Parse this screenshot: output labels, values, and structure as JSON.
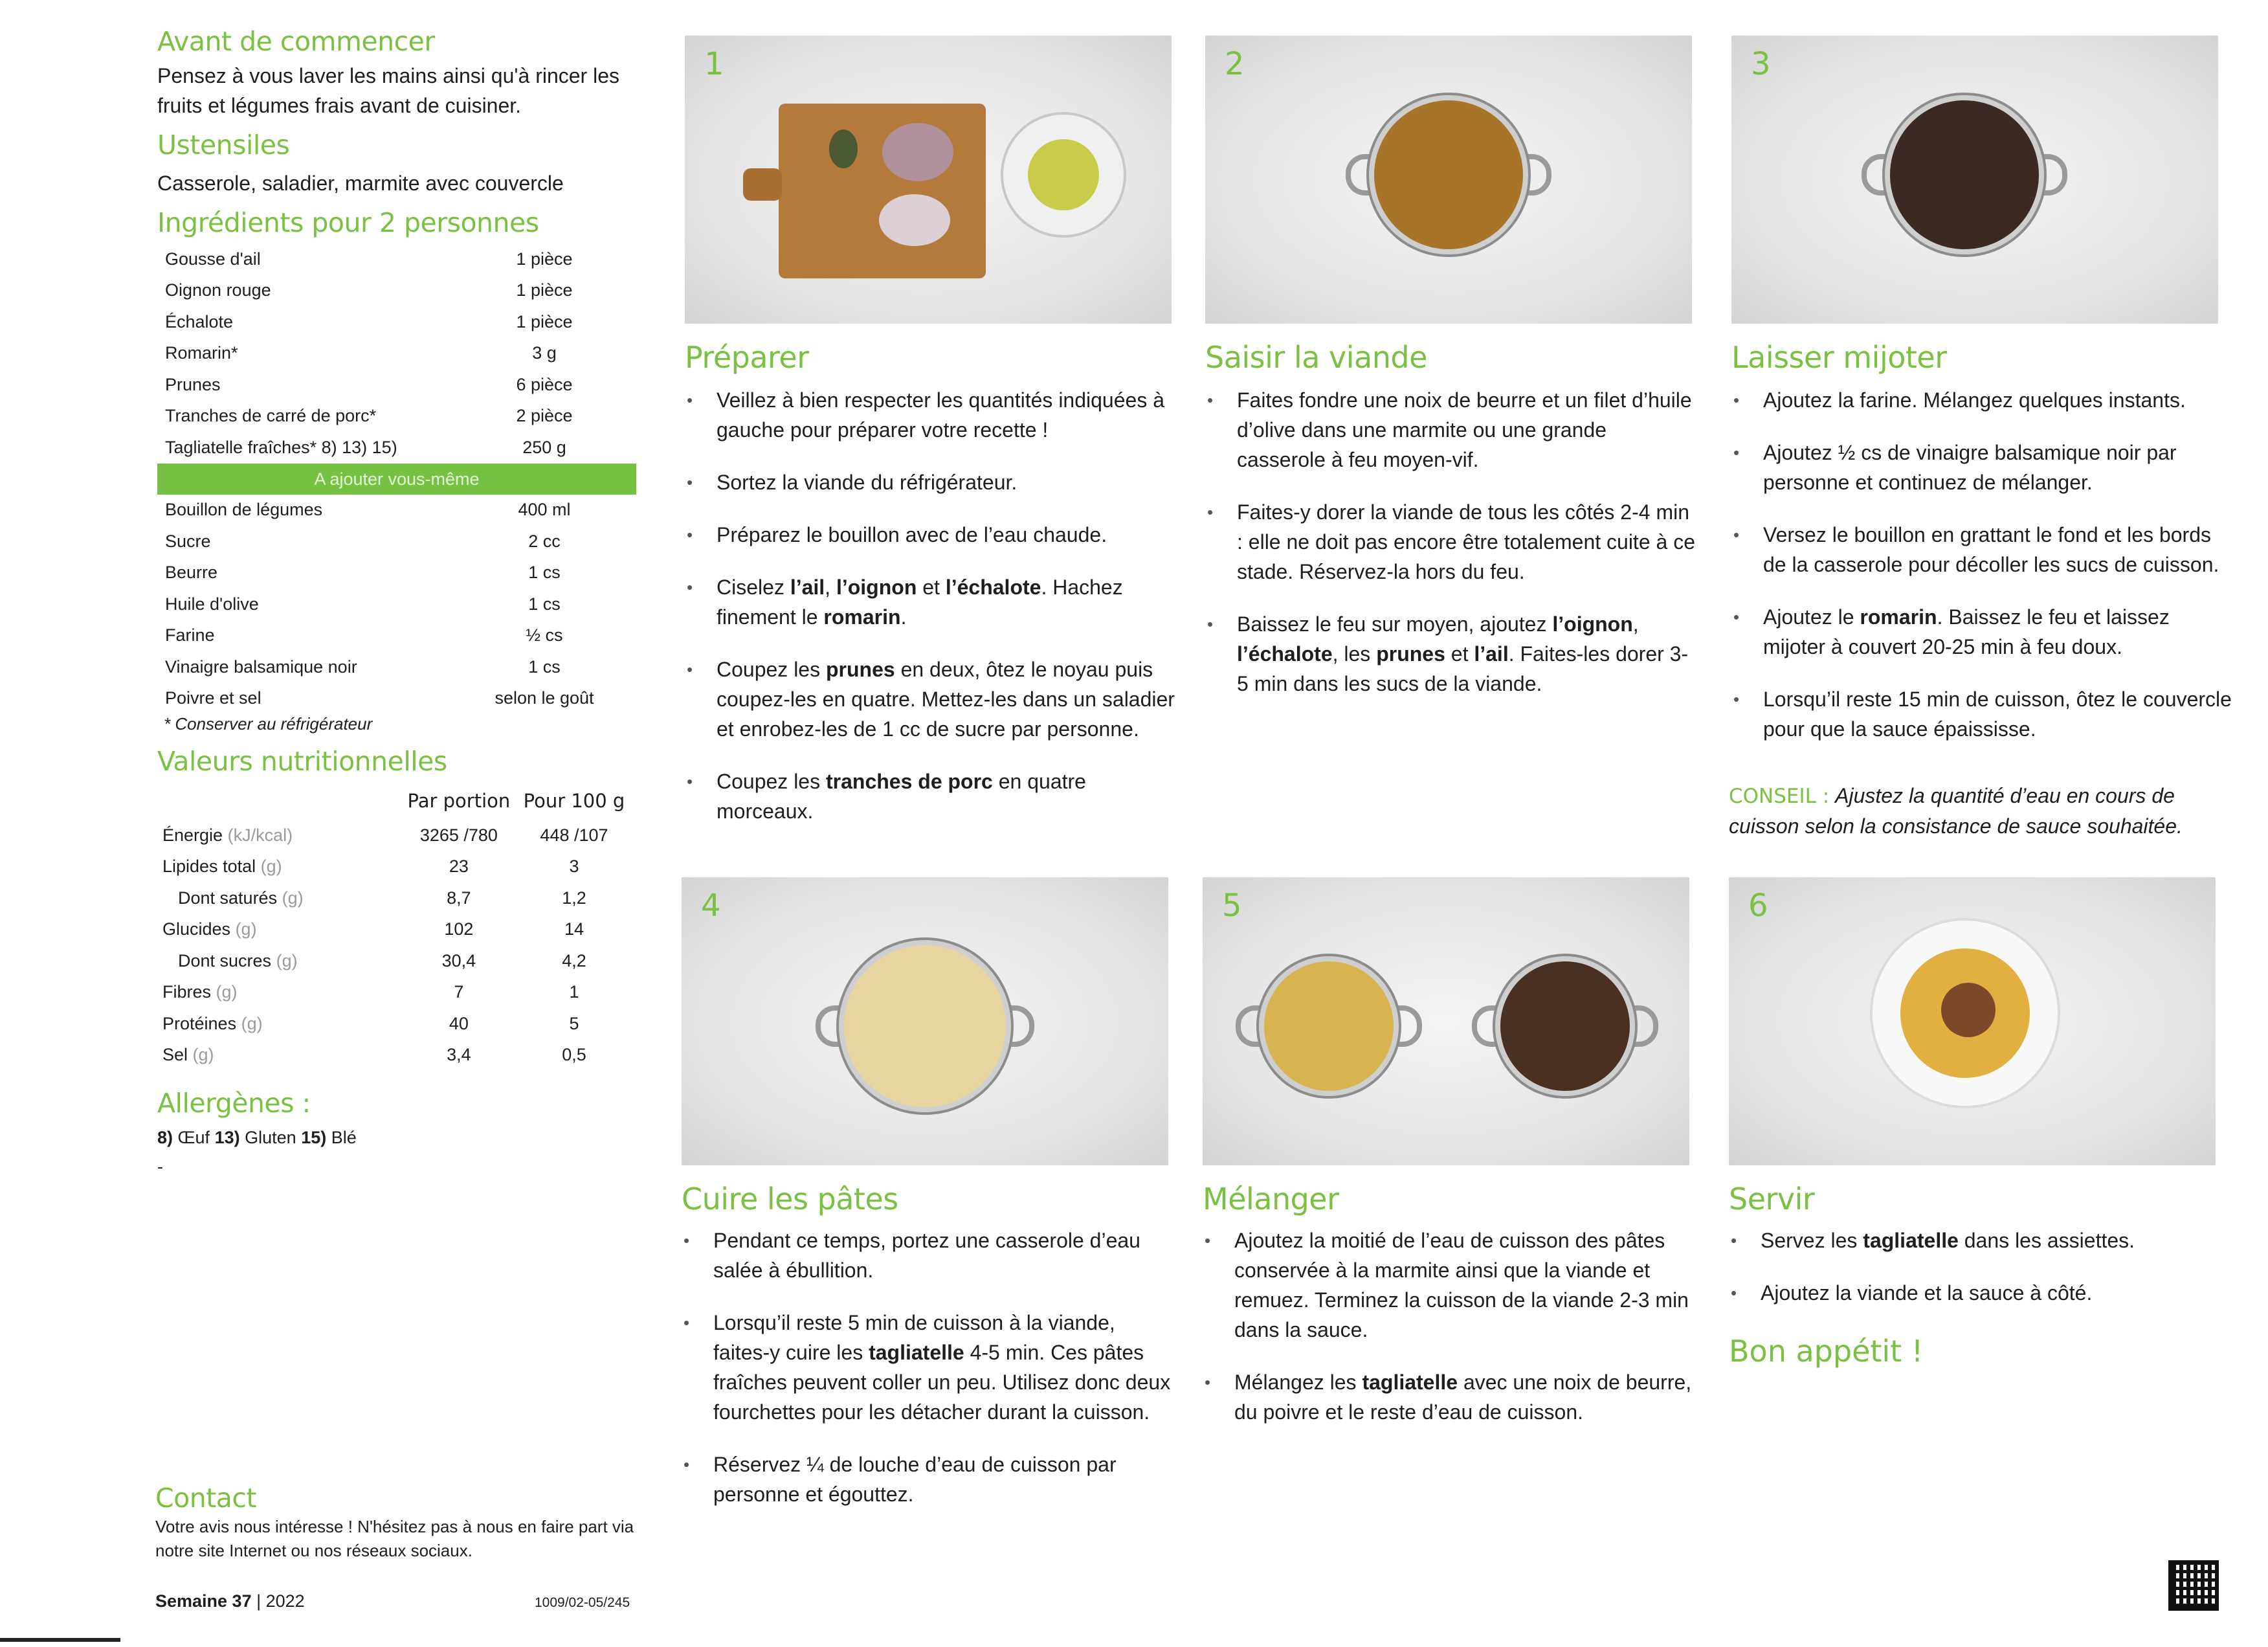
{
  "before": {
    "title": "Avant de commencer",
    "text": "Pensez à vous laver les mains ainsi qu'à rincer les fruits et légumes frais avant de cuisiner."
  },
  "utensils": {
    "title": "Ustensiles",
    "text": "Casserole, saladier, marmite avec couvercle"
  },
  "ingredients": {
    "title": "Ingrédients pour 2 personnes",
    "items": [
      {
        "name": "Gousse d'ail",
        "qty": "1 pièce"
      },
      {
        "name": "Oignon rouge",
        "qty": "1 pièce"
      },
      {
        "name": "Échalote",
        "qty": "1 pièce"
      },
      {
        "name": "Romarin*",
        "qty": "3 g"
      },
      {
        "name": "Prunes",
        "qty": "6 pièce"
      },
      {
        "name": "Tranches de carré de porc*",
        "qty": "2 pièce"
      },
      {
        "name": "Tagliatelle fraîches* 8) 13) 15)",
        "qty": "250 g"
      }
    ],
    "extra_label": "A ajouter vous-même",
    "extra": [
      {
        "name": "Bouillon de légumes",
        "qty": "400 ml"
      },
      {
        "name": "Sucre",
        "qty": "2 cc"
      },
      {
        "name": "Beurre",
        "qty": "1 cs"
      },
      {
        "name": "Huile d'olive",
        "qty": "1 cs"
      },
      {
        "name": "Farine",
        "qty": "½ cs"
      },
      {
        "name": "Vinaigre balsamique noir",
        "qty": "1 cs"
      },
      {
        "name": "Poivre et sel",
        "qty": "selon le goût"
      }
    ],
    "note": "* Conserver au réfrigérateur"
  },
  "nutrition": {
    "title": "Valeurs nutritionnelles",
    "col1": "Par portion",
    "col2": "Pour 100 g",
    "rows": [
      {
        "name": "Énergie",
        "unit": "(kJ/kcal)",
        "v1": "3265 /780",
        "v2": "448 /107",
        "indent": false
      },
      {
        "name": "Lipides total",
        "unit": "(g)",
        "v1": "23",
        "v2": "3",
        "indent": false
      },
      {
        "name": "Dont saturés",
        "unit": "(g)",
        "v1": "8,7",
        "v2": "1,2",
        "indent": true
      },
      {
        "name": "Glucides",
        "unit": "(g)",
        "v1": "102",
        "v2": "14",
        "indent": false
      },
      {
        "name": "Dont sucres",
        "unit": "(g)",
        "v1": "30,4",
        "v2": "4,2",
        "indent": true
      },
      {
        "name": "Fibres",
        "unit": "(g)",
        "v1": "7",
        "v2": "1",
        "indent": false
      },
      {
        "name": "Protéines",
        "unit": "(g)",
        "v1": "40",
        "v2": "5",
        "indent": false
      },
      {
        "name": "Sel",
        "unit": "(g)",
        "v1": "3,4",
        "v2": "0,5",
        "indent": false
      }
    ]
  },
  "allergens": {
    "title": "Allergènes :",
    "items": [
      {
        "num": "8)",
        "label": "Œuf"
      },
      {
        "num": "13)",
        "label": "Gluten"
      },
      {
        "num": "15)",
        "label": "Blé"
      }
    ],
    "dash": "-"
  },
  "contact": {
    "title": "Contact",
    "text": "Votre avis nous intéresse ! N'hésitez pas à nous en faire part via notre site Internet ou nos réseaux sociaux."
  },
  "footer": {
    "week_label": "Semaine 37",
    "year": "2022",
    "code": "1009/02-05/245"
  },
  "steps": [
    {
      "num": "1",
      "title": "Préparer",
      "photo": "cutting-board-chopped-garlic-onion-rosemary-and-bowl-of-plums",
      "bullets": [
        [
          {
            "t": "Veillez à bien respecter les quantités indiquées à gauche pour préparer votre recette !"
          }
        ],
        [
          {
            "t": "Sortez la viande du réfrigérateur."
          }
        ],
        [
          {
            "t": "Préparez le bouillon avec de l’eau chaude."
          }
        ],
        [
          {
            "t": "Ciselez "
          },
          {
            "t": "l’ail",
            "b": true
          },
          {
            "t": ", "
          },
          {
            "t": "l’oignon",
            "b": true
          },
          {
            "t": " et "
          },
          {
            "t": "l’échalote",
            "b": true
          },
          {
            "t": ". Hachez finement le "
          },
          {
            "t": "romarin",
            "b": true
          },
          {
            "t": "."
          }
        ],
        [
          {
            "t": "Coupez les "
          },
          {
            "t": "prunes",
            "b": true
          },
          {
            "t": " en deux, ôtez le noyau puis coupez-les en quatre. Mettez-les dans un saladier et enrobez-les de 1 cc de sucre par personne."
          }
        ],
        [
          {
            "t": "Coupez les "
          },
          {
            "t": "tranches de porc",
            "b": true
          },
          {
            "t": " en quatre morceaux."
          }
        ]
      ]
    },
    {
      "num": "2",
      "title": "Saisir la viande",
      "photo": "pot-with-seared-meat-and-plums",
      "bullets": [
        [
          {
            "t": "Faites fondre une noix de beurre et un filet d’huile d’olive dans une marmite ou une grande casserole à feu moyen-vif."
          }
        ],
        [
          {
            "t": "Faites-y dorer la viande de tous les côtés 2-4 min : elle ne doit pas encore être totalement cuite à ce stade. Réservez-la hors du feu."
          }
        ],
        [
          {
            "t": "Baissez le feu sur moyen, ajoutez "
          },
          {
            "t": "l’oignon",
            "b": true
          },
          {
            "t": ", "
          },
          {
            "t": "l’échalote",
            "b": true
          },
          {
            "t": ", les "
          },
          {
            "t": "prunes",
            "b": true
          },
          {
            "t": " et "
          },
          {
            "t": "l’ail",
            "b": true
          },
          {
            "t": ". Faites-les dorer 3-5 min dans les sucs de la viande."
          }
        ]
      ]
    },
    {
      "num": "3",
      "title": "Laisser mijoter",
      "photo": "pot-with-simmering-dark-sauce",
      "bullets": [
        [
          {
            "t": "Ajoutez la farine. Mélangez quelques instants."
          }
        ],
        [
          {
            "t": "Ajoutez ½ cs de vinaigre balsamique noir par personne et continuez de mélanger."
          }
        ],
        [
          {
            "t": "Versez le bouillon en grattant le fond et les bords de la casserole pour décoller les sucs de cuisson."
          }
        ],
        [
          {
            "t": "Ajoutez le "
          },
          {
            "t": "romarin",
            "b": true
          },
          {
            "t": ". Baissez le feu et laissez mijoter à couvert 20-25 min à feu doux."
          }
        ],
        [
          {
            "t": "Lorsqu’il reste 15 min de cuisson, ôtez le couvercle pour que la sauce épaississe."
          }
        ]
      ],
      "tip_label": "CONSEIL :",
      "tip": "Ajustez la quantité d’eau en cours de cuisson selon la consistance de sauce souhaitée."
    },
    {
      "num": "4",
      "title": "Cuire les pâtes",
      "photo": "pot-with-tagliatelle-in-boiling-water",
      "bullets": [
        [
          {
            "t": "Pendant ce temps, portez une casserole d’eau salée à ébullition."
          }
        ],
        [
          {
            "t": "Lorsqu’il reste 5 min de cuisson à la viande, faites-y cuire les "
          },
          {
            "t": "tagliatelle",
            "b": true
          },
          {
            "t": " 4-5 min. Ces pâtes fraîches peuvent coller un peu. Utilisez donc deux fourchettes pour les détacher durant la cuisson."
          }
        ],
        [
          {
            "t": "Réservez ¼ de louche d’eau de cuisson par personne et égouttez."
          }
        ]
      ]
    },
    {
      "num": "5",
      "title": "Mélanger",
      "photo": "pot-of-tagliatelle-and-pot-of-meat-sauce",
      "bullets": [
        [
          {
            "t": "Ajoutez la moitié de l’eau de cuisson des pâtes conservée à la marmite ainsi que la viande et remuez. Terminez la cuisson de la viande 2-3 min dans la sauce."
          }
        ],
        [
          {
            "t": "Mélangez les "
          },
          {
            "t": "tagliatelle",
            "b": true
          },
          {
            "t": " avec une noix de beurre, du poivre et le reste d’eau de cuisson."
          }
        ]
      ]
    },
    {
      "num": "6",
      "title": "Servir",
      "photo": "plate-of-tagliatelle-with-pork-and-plum-sauce",
      "bullets": [
        [
          {
            "t": "Servez les "
          },
          {
            "t": "tagliatelle",
            "b": true
          },
          {
            "t": " dans les assiettes."
          }
        ],
        [
          {
            "t": "Ajoutez la viande et la sauce à côté."
          }
        ]
      ],
      "closing": "Bon appétit !"
    }
  ],
  "colors": {
    "accent": "#7ac143",
    "bar": "#76c043",
    "text": "#1e1e1e"
  }
}
